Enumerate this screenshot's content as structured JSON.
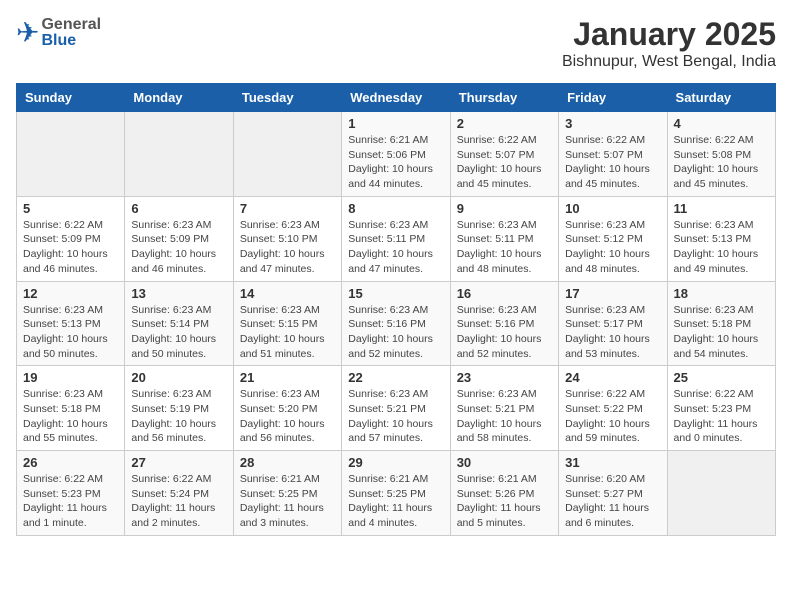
{
  "header": {
    "logo_general": "General",
    "logo_blue": "Blue",
    "title": "January 2025",
    "subtitle": "Bishnupur, West Bengal, India"
  },
  "days_of_week": [
    "Sunday",
    "Monday",
    "Tuesday",
    "Wednesday",
    "Thursday",
    "Friday",
    "Saturday"
  ],
  "weeks": [
    [
      {
        "day": "",
        "info": ""
      },
      {
        "day": "",
        "info": ""
      },
      {
        "day": "",
        "info": ""
      },
      {
        "day": "1",
        "info": "Sunrise: 6:21 AM\nSunset: 5:06 PM\nDaylight: 10 hours\nand 44 minutes."
      },
      {
        "day": "2",
        "info": "Sunrise: 6:22 AM\nSunset: 5:07 PM\nDaylight: 10 hours\nand 45 minutes."
      },
      {
        "day": "3",
        "info": "Sunrise: 6:22 AM\nSunset: 5:07 PM\nDaylight: 10 hours\nand 45 minutes."
      },
      {
        "day": "4",
        "info": "Sunrise: 6:22 AM\nSunset: 5:08 PM\nDaylight: 10 hours\nand 45 minutes."
      }
    ],
    [
      {
        "day": "5",
        "info": "Sunrise: 6:22 AM\nSunset: 5:09 PM\nDaylight: 10 hours\nand 46 minutes."
      },
      {
        "day": "6",
        "info": "Sunrise: 6:23 AM\nSunset: 5:09 PM\nDaylight: 10 hours\nand 46 minutes."
      },
      {
        "day": "7",
        "info": "Sunrise: 6:23 AM\nSunset: 5:10 PM\nDaylight: 10 hours\nand 47 minutes."
      },
      {
        "day": "8",
        "info": "Sunrise: 6:23 AM\nSunset: 5:11 PM\nDaylight: 10 hours\nand 47 minutes."
      },
      {
        "day": "9",
        "info": "Sunrise: 6:23 AM\nSunset: 5:11 PM\nDaylight: 10 hours\nand 48 minutes."
      },
      {
        "day": "10",
        "info": "Sunrise: 6:23 AM\nSunset: 5:12 PM\nDaylight: 10 hours\nand 48 minutes."
      },
      {
        "day": "11",
        "info": "Sunrise: 6:23 AM\nSunset: 5:13 PM\nDaylight: 10 hours\nand 49 minutes."
      }
    ],
    [
      {
        "day": "12",
        "info": "Sunrise: 6:23 AM\nSunset: 5:13 PM\nDaylight: 10 hours\nand 50 minutes."
      },
      {
        "day": "13",
        "info": "Sunrise: 6:23 AM\nSunset: 5:14 PM\nDaylight: 10 hours\nand 50 minutes."
      },
      {
        "day": "14",
        "info": "Sunrise: 6:23 AM\nSunset: 5:15 PM\nDaylight: 10 hours\nand 51 minutes."
      },
      {
        "day": "15",
        "info": "Sunrise: 6:23 AM\nSunset: 5:16 PM\nDaylight: 10 hours\nand 52 minutes."
      },
      {
        "day": "16",
        "info": "Sunrise: 6:23 AM\nSunset: 5:16 PM\nDaylight: 10 hours\nand 52 minutes."
      },
      {
        "day": "17",
        "info": "Sunrise: 6:23 AM\nSunset: 5:17 PM\nDaylight: 10 hours\nand 53 minutes."
      },
      {
        "day": "18",
        "info": "Sunrise: 6:23 AM\nSunset: 5:18 PM\nDaylight: 10 hours\nand 54 minutes."
      }
    ],
    [
      {
        "day": "19",
        "info": "Sunrise: 6:23 AM\nSunset: 5:18 PM\nDaylight: 10 hours\nand 55 minutes."
      },
      {
        "day": "20",
        "info": "Sunrise: 6:23 AM\nSunset: 5:19 PM\nDaylight: 10 hours\nand 56 minutes."
      },
      {
        "day": "21",
        "info": "Sunrise: 6:23 AM\nSunset: 5:20 PM\nDaylight: 10 hours\nand 56 minutes."
      },
      {
        "day": "22",
        "info": "Sunrise: 6:23 AM\nSunset: 5:21 PM\nDaylight: 10 hours\nand 57 minutes."
      },
      {
        "day": "23",
        "info": "Sunrise: 6:23 AM\nSunset: 5:21 PM\nDaylight: 10 hours\nand 58 minutes."
      },
      {
        "day": "24",
        "info": "Sunrise: 6:22 AM\nSunset: 5:22 PM\nDaylight: 10 hours\nand 59 minutes."
      },
      {
        "day": "25",
        "info": "Sunrise: 6:22 AM\nSunset: 5:23 PM\nDaylight: 11 hours\nand 0 minutes."
      }
    ],
    [
      {
        "day": "26",
        "info": "Sunrise: 6:22 AM\nSunset: 5:23 PM\nDaylight: 11 hours\nand 1 minute."
      },
      {
        "day": "27",
        "info": "Sunrise: 6:22 AM\nSunset: 5:24 PM\nDaylight: 11 hours\nand 2 minutes."
      },
      {
        "day": "28",
        "info": "Sunrise: 6:21 AM\nSunset: 5:25 PM\nDaylight: 11 hours\nand 3 minutes."
      },
      {
        "day": "29",
        "info": "Sunrise: 6:21 AM\nSunset: 5:25 PM\nDaylight: 11 hours\nand 4 minutes."
      },
      {
        "day": "30",
        "info": "Sunrise: 6:21 AM\nSunset: 5:26 PM\nDaylight: 11 hours\nand 5 minutes."
      },
      {
        "day": "31",
        "info": "Sunrise: 6:20 AM\nSunset: 5:27 PM\nDaylight: 11 hours\nand 6 minutes."
      },
      {
        "day": "",
        "info": ""
      }
    ]
  ]
}
